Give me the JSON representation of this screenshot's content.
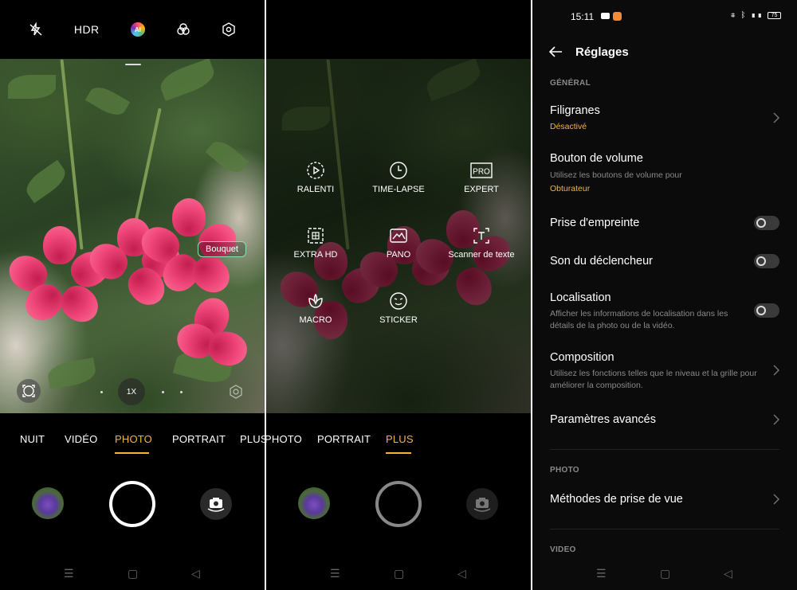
{
  "camera_top": {
    "flash_icon": "flash-off-icon",
    "hdr_label": "HDR",
    "ai_label": "AI",
    "filter_icon": "filters-icon",
    "settings_icon": "settings-hex-icon"
  },
  "viewfinder": {
    "scene_label": "Bouquet",
    "zoom_label": "1X"
  },
  "modes_photo": [
    "NUIT",
    "VIDÉO",
    "PHOTO",
    "PORTRAIT",
    "PLUS"
  ],
  "modes_photo_active": "PHOTO",
  "modes_plus": [
    "PHOTO",
    "PORTRAIT",
    "PLUS"
  ],
  "modes_plus_active": "PLUS",
  "plus_menu": [
    {
      "icon": "slow-motion-icon",
      "label": "RALENTI"
    },
    {
      "icon": "time-lapse-icon",
      "label": "TIME-LAPSE"
    },
    {
      "icon": "pro-icon",
      "label": "EXPERT",
      "icon_text": "PRO"
    },
    {
      "icon": "extra-hd-icon",
      "label": "EXTRA HD"
    },
    {
      "icon": "pano-icon",
      "label": "PANO"
    },
    {
      "icon": "text-scanner-icon",
      "label": "Scanner de texte"
    },
    {
      "icon": "macro-icon",
      "label": "MACRO"
    },
    {
      "icon": "sticker-icon",
      "label": "STICKER"
    }
  ],
  "status_bar": {
    "time": "15:11",
    "battery": "75"
  },
  "settings": {
    "title": "Réglages",
    "section_general": "GÉNÉRAL",
    "watermark_title": "Filigranes",
    "watermark_value": "Désactivé",
    "volume_title": "Bouton de volume",
    "volume_sub": "Utilisez les boutons de volume pour",
    "volume_value": "Obturateur",
    "fingerprint_title": "Prise d'empreinte",
    "shutter_sound_title": "Son du déclencheur",
    "location_title": "Localisation",
    "location_sub": "Afficher les informations de localisation dans les détails de la photo ou de la vidéo.",
    "composition_title": "Composition",
    "composition_sub": "Utilisez les fonctions telles que le niveau et la grille pour améliorer la composition.",
    "advanced_title": "Paramètres avancés",
    "section_photo": "PHOTO",
    "shooting_methods_title": "Méthodes de prise de vue",
    "section_video": "VIDEO"
  },
  "colors": {
    "accent": "#f7b23b",
    "bouquet_border": "#8fe0b0"
  }
}
